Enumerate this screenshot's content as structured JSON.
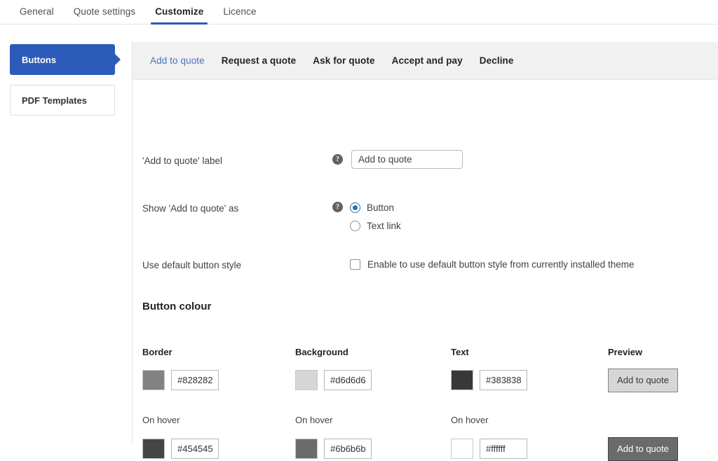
{
  "top_tabs": [
    {
      "label": "General",
      "active": false
    },
    {
      "label": "Quote settings",
      "active": false
    },
    {
      "label": "Customize",
      "active": true
    },
    {
      "label": "Licence",
      "active": false
    }
  ],
  "sidebar": {
    "items": [
      {
        "label": "Buttons",
        "active": true
      },
      {
        "label": "PDF Templates",
        "active": false
      }
    ]
  },
  "subtabs": [
    {
      "label": "Add to quote",
      "active": true
    },
    {
      "label": "Request a quote",
      "active": false
    },
    {
      "label": "Ask for quote",
      "active": false
    },
    {
      "label": "Accept and pay",
      "active": false
    },
    {
      "label": "Decline",
      "active": false
    }
  ],
  "fields": {
    "label_row": {
      "label": "'Add to quote' label",
      "help": "?",
      "value": "Add to quote",
      "placeholder": "Add to quote"
    },
    "show_as_row": {
      "label": "Show 'Add to quote' as",
      "help": "?",
      "options": [
        {
          "label": "Button",
          "checked": true
        },
        {
          "label": "Text link",
          "checked": false
        }
      ]
    },
    "default_style_row": {
      "label": "Use default button style",
      "checkbox_label": "Enable to use default button style from currently installed theme",
      "checked": false
    }
  },
  "button_colour": {
    "title": "Button colour",
    "columns": [
      {
        "header": "Border",
        "hover_label": "On hover"
      },
      {
        "header": "Background",
        "hover_label": "On hover"
      },
      {
        "header": "Text",
        "hover_label": "On hover"
      },
      {
        "header": "Preview",
        "hover_label": ""
      }
    ],
    "normal": {
      "border": "#828282",
      "background": "#d6d6d6",
      "text": "#383838",
      "preview_label": "Add to quote"
    },
    "hover": {
      "border": "#454545",
      "background": "#6b6b6b",
      "text": "#ffffff",
      "preview_label": "Add to quote"
    }
  },
  "theme": {
    "accent": "#2d5bb9",
    "link": "#4a72c4",
    "panel_header_bg": "#f1f1f1"
  }
}
